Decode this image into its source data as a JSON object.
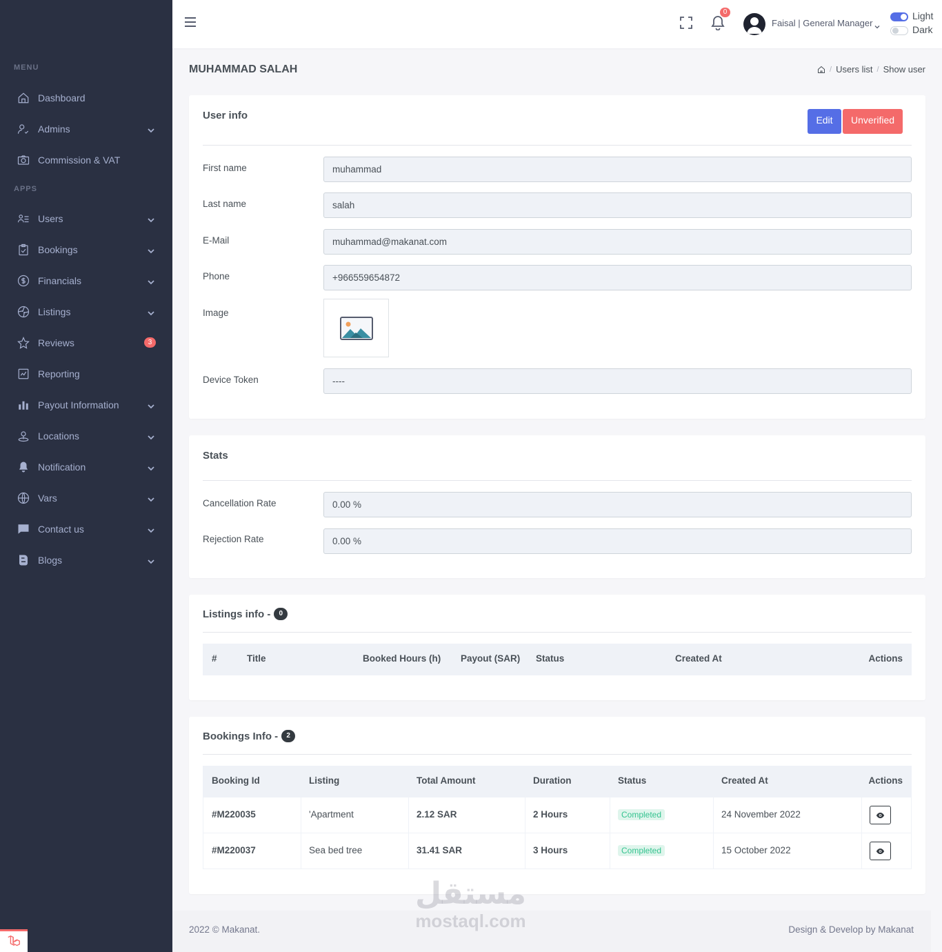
{
  "sidebar": {
    "menu_title": "MENU",
    "apps_title": "APPS",
    "items": [
      {
        "label": "Dashboard",
        "icon": "home-icon",
        "has_children": false
      },
      {
        "label": "Admins",
        "icon": "user-check-icon",
        "has_children": true
      },
      {
        "label": "Commission & VAT",
        "icon": "camera-icon",
        "has_children": false
      },
      {
        "label": "Users",
        "icon": "users-list-icon",
        "has_children": true
      },
      {
        "label": "Bookings",
        "icon": "clipboard-icon",
        "has_children": true
      },
      {
        "label": "Financials",
        "icon": "dollar-circle-icon",
        "has_children": true
      },
      {
        "label": "Listings",
        "icon": "aperture-icon",
        "has_children": true
      },
      {
        "label": "Reviews",
        "icon": "star-icon",
        "badge": "3"
      },
      {
        "label": "Reporting",
        "icon": "chart-line-icon",
        "has_children": false
      },
      {
        "label": "Payout Information",
        "icon": "bar-chart-icon",
        "has_children": true
      },
      {
        "label": "Locations",
        "icon": "map-pin-icon",
        "has_children": true
      },
      {
        "label": "Notification",
        "icon": "bell-icon",
        "has_children": true
      },
      {
        "label": "Vars",
        "icon": "globe-icon",
        "has_children": true
      },
      {
        "label": "Contact us",
        "icon": "message-icon",
        "has_children": true
      },
      {
        "label": "Blogs",
        "icon": "blog-icon",
        "has_children": true
      }
    ]
  },
  "topbar": {
    "notification_count": "0",
    "user_name": "Faisal | General Manager",
    "theme_light": "Light",
    "theme_dark": "Dark"
  },
  "page": {
    "title": "MUHAMMAD SALAH",
    "breadcrumb": [
      "Users list",
      "Show user"
    ]
  },
  "user_info": {
    "title": "User info",
    "edit_label": "Edit",
    "unverified_label": "Unverified",
    "fields": {
      "first_name_label": "First name",
      "first_name": "muhammad",
      "last_name_label": "Last name",
      "last_name": "salah",
      "email_label": "E-Mail",
      "email": "muhammad@makanat.com",
      "phone_label": "Phone",
      "phone": "+966559654872",
      "image_label": "Image",
      "device_token_label": "Device Token",
      "device_token": "----"
    }
  },
  "stats": {
    "title": "Stats",
    "cancellation_label": "Cancellation Rate",
    "cancellation": "0.00 %",
    "rejection_label": "Rejection Rate",
    "rejection": "0.00 %"
  },
  "listings_info": {
    "title": "Listings info -",
    "count": "0",
    "columns": [
      "#",
      "Title",
      "Booked Hours (h)",
      "Payout (SAR)",
      "Status",
      "Created At",
      "Actions"
    ]
  },
  "bookings_info": {
    "title": "Bookings Info -",
    "count": "2",
    "columns": [
      "Booking Id",
      "Listing",
      "Total Amount",
      "Duration",
      "Status",
      "Created At",
      "Actions"
    ],
    "rows": [
      {
        "id": "#M220035",
        "listing": "'Apartment",
        "amount": "2.12 SAR",
        "duration": "2 Hours",
        "status": "Completed",
        "created": "24 November 2022"
      },
      {
        "id": "#M220037",
        "listing": "Sea bed tree",
        "amount": "31.41 SAR",
        "duration": "3 Hours",
        "status": "Completed",
        "created": "15 October 2022"
      }
    ]
  },
  "footer": {
    "left": "2022 © Makanat.",
    "right": "Design & Develop by Makanat"
  },
  "watermark": {
    "arabic": "مستقل",
    "latin": "mostaql.com"
  },
  "colors": {
    "sidebar_bg": "#2a3042",
    "primary": "#556ee6",
    "danger": "#f46a6a",
    "success": "#34c38f"
  }
}
